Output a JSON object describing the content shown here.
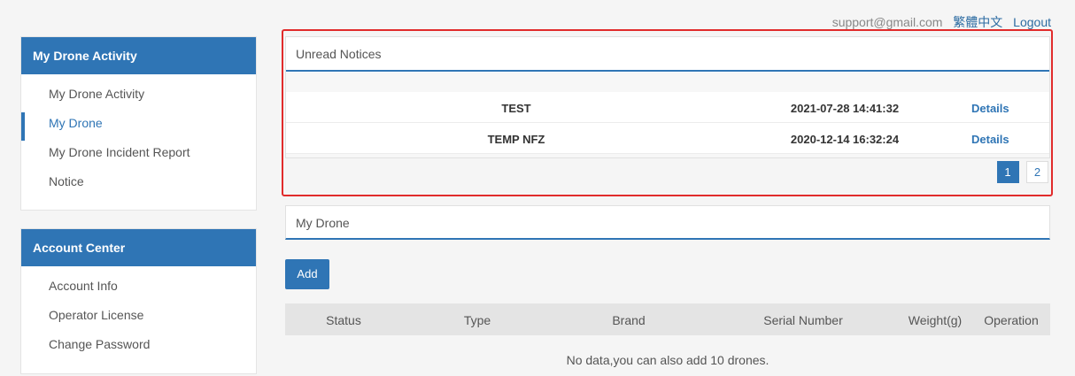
{
  "topbar": {
    "email": "support@gmail.com",
    "language_link": "繁體中文",
    "logout_link": "Logout"
  },
  "sidebar": {
    "activity_section": {
      "heading": "My Drone Activity",
      "items": [
        {
          "label": "My Drone Activity"
        },
        {
          "label": "My Drone",
          "active": true
        },
        {
          "label": "My Drone Incident Report"
        },
        {
          "label": "Notice"
        }
      ]
    },
    "account_section": {
      "heading": "Account Center",
      "items": [
        {
          "label": "Account Info"
        },
        {
          "label": "Operator License"
        },
        {
          "label": "Change Password"
        }
      ]
    }
  },
  "notices": {
    "title": "Unread Notices",
    "rows": [
      {
        "title": "TEST",
        "date": "2021-07-28 14:41:32",
        "link": "Details"
      },
      {
        "title": "TEMP NFZ",
        "date": "2020-12-14 16:32:24",
        "link": "Details"
      }
    ],
    "pages": [
      "1",
      "2"
    ],
    "current_page": "1",
    "highlight_color": "#e12b2b"
  },
  "drone": {
    "title": "My Drone",
    "add_label": "Add",
    "columns": [
      "Status",
      "Type",
      "Brand",
      "Serial Number",
      "Weight(g)",
      "Operation"
    ],
    "empty_message": "No data,you can also add 10 drones."
  },
  "colors": {
    "accent": "#2f75b5",
    "background": "#f5f5f5"
  }
}
